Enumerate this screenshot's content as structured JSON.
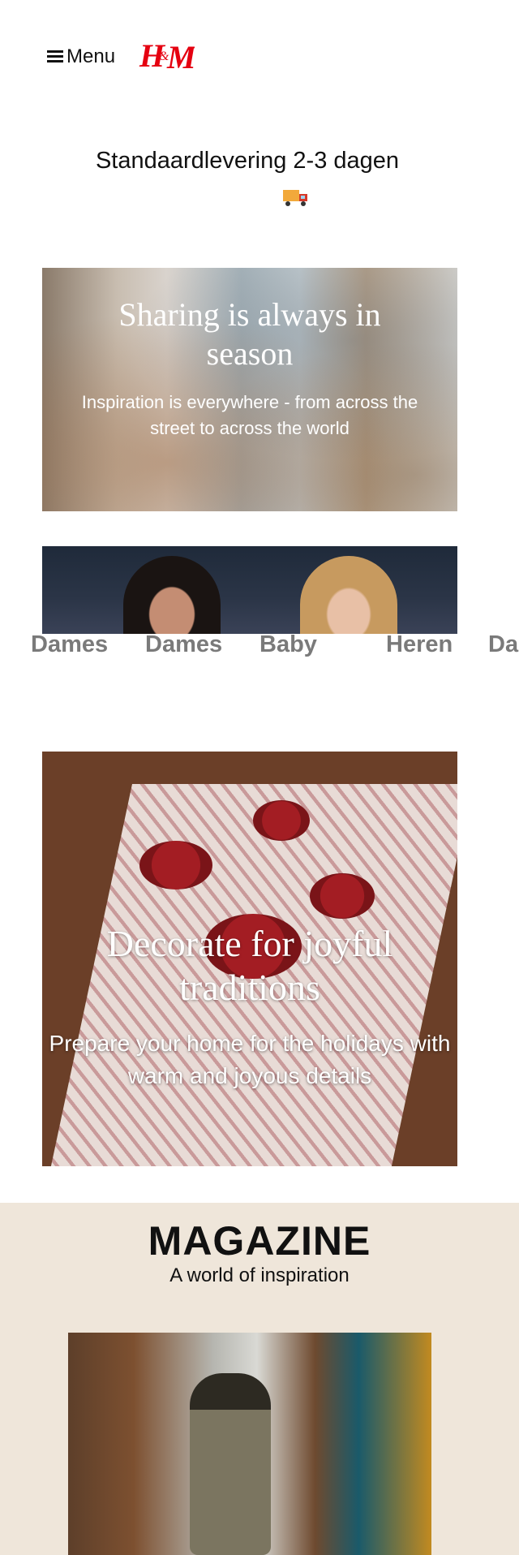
{
  "header": {
    "menu_label": "Menu",
    "logo_text": "H&M",
    "logo_color": "#e50010"
  },
  "delivery": {
    "text": "Standaardlevering 2-3 dagen",
    "icon": "delivery-truck-icon"
  },
  "hero": {
    "title": "Sharing is always in season",
    "subtitle": "Inspiration is everywhere - from across the street to across the world"
  },
  "categories": {
    "items": [
      "Dames",
      "Dames",
      "Baby",
      "Heren",
      "Da"
    ]
  },
  "decorate": {
    "title": "Decorate for joyful traditions",
    "subtitle": "Prepare your home for the holidays with warm and joyous details"
  },
  "magazine": {
    "title": "MAGAZINE",
    "subtitle": "A world of inspiration",
    "background": "#efe6da"
  }
}
